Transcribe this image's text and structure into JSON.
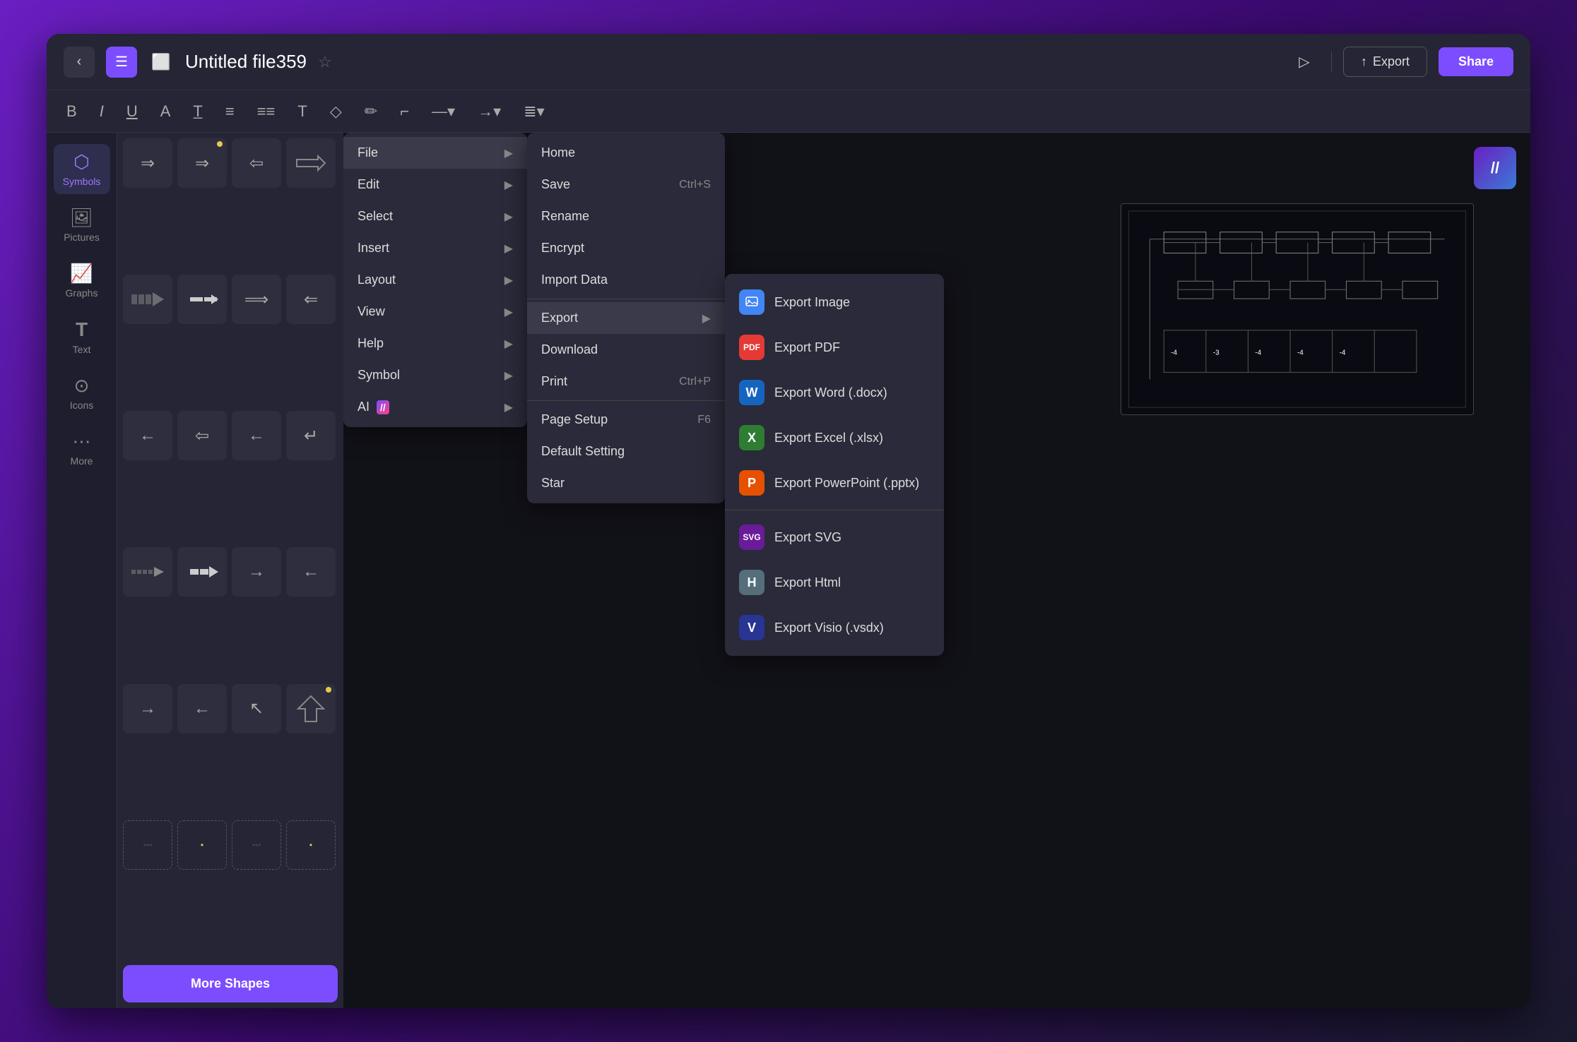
{
  "titleBar": {
    "backLabel": "‹",
    "menuLabel": "☰",
    "saveLabel": "⬜",
    "fileTitle": "Untitled file359",
    "starLabel": "☆",
    "playLabel": "▷",
    "exportLabel": "Export",
    "shareLabel": "Share"
  },
  "toolbar": {
    "icons": [
      "B",
      "I",
      "U",
      "A",
      "T̲",
      "≡",
      "≡≡",
      "T",
      "◇",
      "✏",
      "⌐",
      "—",
      "→",
      "≣"
    ]
  },
  "sidebar": {
    "items": [
      {
        "id": "symbols",
        "icon": "⬡",
        "label": "Symbols",
        "active": true
      },
      {
        "id": "pictures",
        "icon": "🖼",
        "label": "Pictures",
        "active": false
      },
      {
        "id": "graphs",
        "icon": "📈",
        "label": "Graphs",
        "active": false
      },
      {
        "id": "text",
        "icon": "T",
        "label": "Text",
        "active": false
      },
      {
        "id": "icons",
        "icon": "⊙",
        "label": "Icons",
        "active": false
      },
      {
        "id": "more",
        "icon": "⋯",
        "label": "More",
        "active": false
      }
    ]
  },
  "moreShapesBtn": "More Shapes",
  "avatar": "//",
  "fileMenu": {
    "items": [
      {
        "label": "File",
        "hasArrow": true,
        "active": true
      },
      {
        "label": "Edit",
        "hasArrow": true
      },
      {
        "label": "Select",
        "hasArrow": true
      },
      {
        "label": "Insert",
        "hasArrow": true
      },
      {
        "label": "Layout",
        "hasArrow": true
      },
      {
        "label": "View",
        "hasArrow": true
      },
      {
        "label": "Help",
        "hasArrow": true
      },
      {
        "label": "Symbol",
        "hasArrow": true
      },
      {
        "label": "AI",
        "hasArrow": true,
        "hasAiIcon": true
      }
    ]
  },
  "fileSubmenu": {
    "items": [
      {
        "label": "Home",
        "shortcut": "",
        "hasSeparator": false
      },
      {
        "label": "Save",
        "shortcut": "Ctrl+S",
        "hasSeparator": false
      },
      {
        "label": "Rename",
        "shortcut": "",
        "hasSeparator": false
      },
      {
        "label": "Encrypt",
        "shortcut": "",
        "hasSeparator": false
      },
      {
        "label": "Import Data",
        "shortcut": "",
        "hasSeparator": false
      },
      {
        "label": "Export",
        "shortcut": "",
        "hasSeparator": false,
        "hasArrow": true,
        "active": true
      },
      {
        "label": "Download",
        "shortcut": "",
        "hasSeparator": false
      },
      {
        "label": "Print",
        "shortcut": "Ctrl+P",
        "hasSeparator": false
      },
      {
        "label": "Page Setup",
        "shortcut": "F6",
        "hasSeparator": false
      },
      {
        "label": "Default Setting",
        "shortcut": "",
        "hasSeparator": false
      },
      {
        "label": "Star",
        "shortcut": "",
        "hasSeparator": false
      }
    ]
  },
  "exportSubmenu": {
    "items": [
      {
        "label": "Export Image",
        "icon": "🖼",
        "iconClass": "icon-blue",
        "iconText": "⬡"
      },
      {
        "label": "Export PDF",
        "icon": "PDF",
        "iconClass": "icon-red",
        "iconText": "PDF"
      },
      {
        "label": "Export Word (.docx)",
        "icon": "W",
        "iconClass": "icon-word",
        "iconText": "W"
      },
      {
        "label": "Export Excel (.xlsx)",
        "icon": "X",
        "iconClass": "icon-green",
        "iconText": "X"
      },
      {
        "label": "Export PowerPoint (.pptx)",
        "icon": "P",
        "iconClass": "icon-orange",
        "iconText": "P"
      },
      {
        "label": "Export SVG",
        "icon": "SVG",
        "iconClass": "icon-purple",
        "iconText": "SVG"
      },
      {
        "label": "Export Html",
        "icon": "H",
        "iconClass": "icon-gray",
        "iconText": "H"
      },
      {
        "label": "Export Visio (.vsdx)",
        "icon": "V",
        "iconClass": "icon-indigo",
        "iconText": "V"
      }
    ]
  }
}
